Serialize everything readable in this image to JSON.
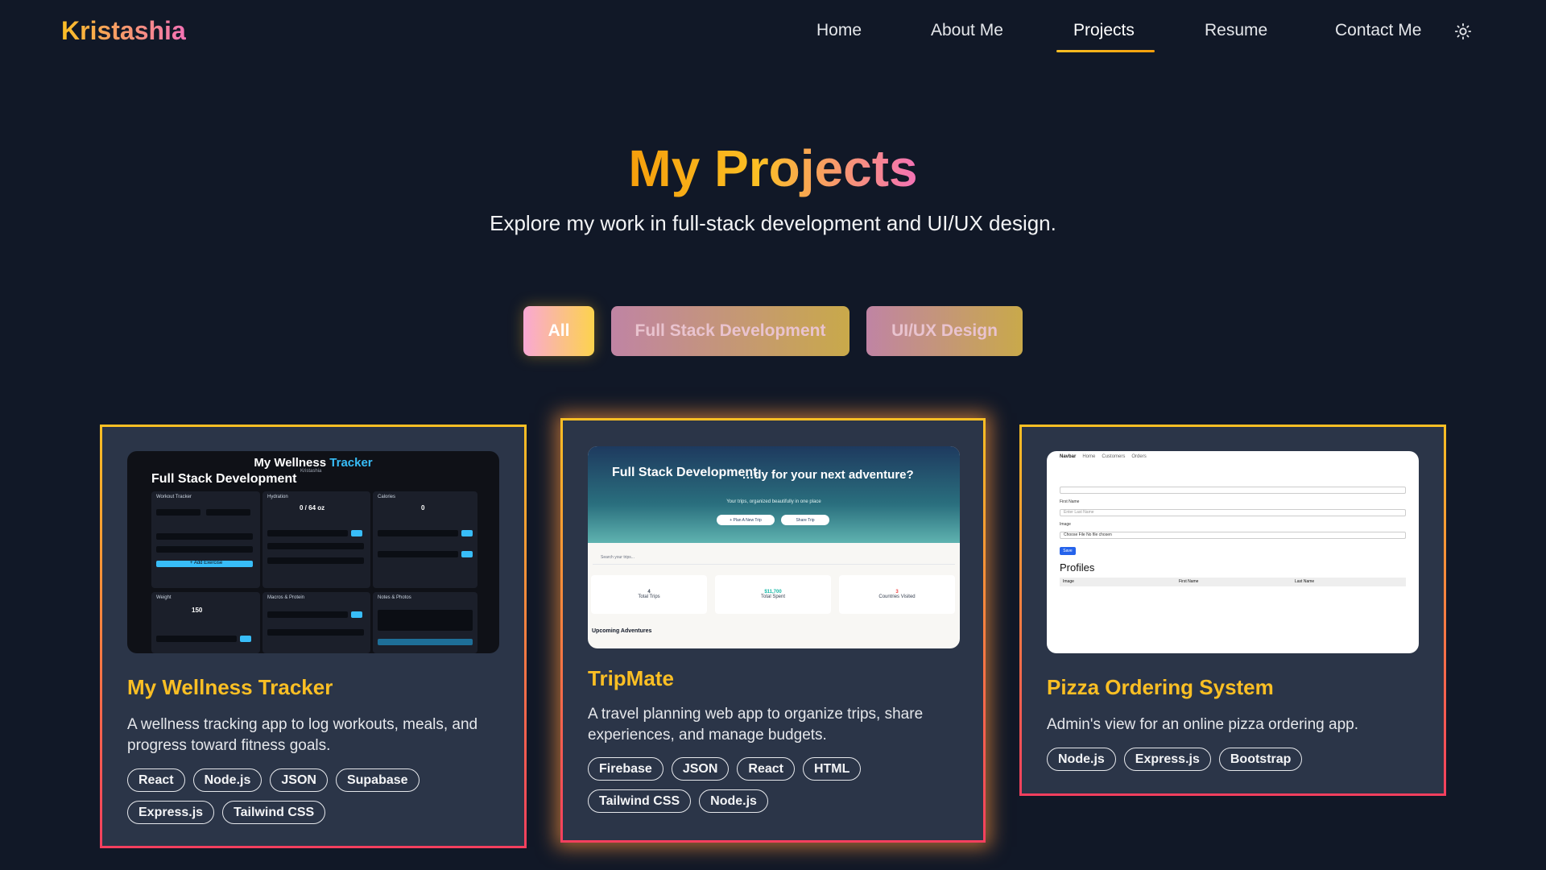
{
  "nav": {
    "logo": "Kristashia",
    "links": [
      "Home",
      "About Me",
      "Projects",
      "Resume",
      "Contact Me"
    ],
    "active": "Projects",
    "theme_icon": "sun-icon"
  },
  "hero": {
    "title": "My Projects",
    "subtitle": "Explore my work in full-stack development and UI/UX design."
  },
  "filters": [
    "All",
    "Full Stack Development",
    "UI/UX Design"
  ],
  "active_filter": "All",
  "colors": {
    "background": "#111827",
    "card": "#2b3548",
    "accent_gold": "#fbbf24",
    "accent_pink": "#f43f5e"
  },
  "projects": [
    {
      "title": "My Wellness Tracker",
      "description": "A wellness tracking app to log workouts, meals, and progress toward fitness goals.",
      "tags": [
        "React",
        "Node.js",
        "JSON",
        "Supabase",
        "Express.js",
        "Tailwind CSS"
      ],
      "thumbnail": {
        "badge": "Full Stack Development",
        "app_title_a": "My Wellness ",
        "app_title_b": "Tracker",
        "user": "Kristashia",
        "panels": [
          "Workout Tracker",
          "Hydration",
          "Calories",
          "Weight",
          "Macros & Protein",
          "Notes & Photos"
        ],
        "hydration_value": "0 / 64 oz",
        "calories_value": "0",
        "weight_value": "150",
        "add_exercise": "+ Add Exercise"
      }
    },
    {
      "title": "TripMate",
      "description": "A travel planning web app to organize trips, share experiences, and manage budgets.",
      "tags": [
        "Firebase",
        "JSON",
        "React",
        "HTML",
        "Tailwind CSS",
        "Node.js"
      ],
      "thumbnail": {
        "badge": "Full Stack Development",
        "headline": "…dy for your next adventure?",
        "tagline": "Your trips, organized beautifully in one place",
        "buttons": [
          "+ Plan A New Trip",
          "Share Trip"
        ],
        "search_placeholder": "Search your trips...",
        "stats": [
          {
            "value": "4",
            "label": "Total Trips"
          },
          {
            "value": "$11,700",
            "label": "Total Spent"
          },
          {
            "value": "3",
            "label": "Countries Visited"
          }
        ],
        "section": "Upcoming Adventures"
      }
    },
    {
      "title": "Pizza Ordering System",
      "description": "Admin's view for an online pizza ordering app.",
      "tags": [
        "Node.js",
        "Express.js",
        "Bootstrap"
      ],
      "thumbnail": {
        "navbar": "Navbar",
        "nav_links": [
          "Home",
          "Customers",
          "Orders"
        ],
        "first_name_label": "First Name",
        "last_name_placeholder": "Enter Last Name",
        "image_label": "Image",
        "file_text": "Choose File   No file chosen",
        "save_label": "Save",
        "profiles_heading": "Profiles",
        "columns": [
          "Image",
          "First Name",
          "Last Name"
        ]
      }
    }
  ]
}
